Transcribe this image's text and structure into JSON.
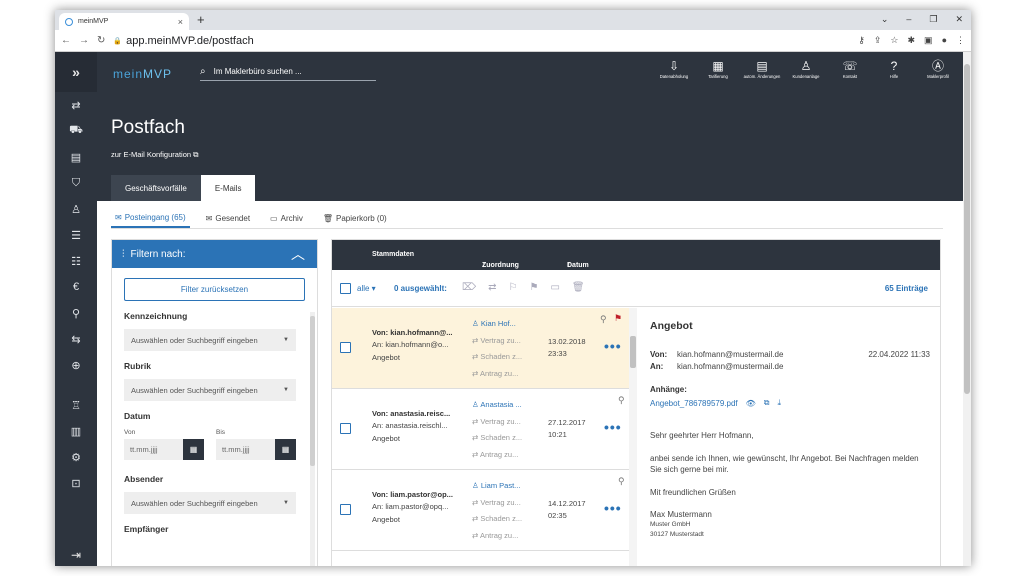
{
  "browser": {
    "tab_title": "meinMVP",
    "url": "app.meinMVP.de/postfach"
  },
  "app": {
    "logo_a": "mein",
    "logo_b": "MVP",
    "search_placeholder": "Im Maklerbüro suchen ...",
    "toolbar": [
      {
        "label": "Datenabholung",
        "icon": "data-retrieval-icon"
      },
      {
        "label": "Tarifierung",
        "icon": "calculator-icon"
      },
      {
        "label": "autom. Änderungen",
        "icon": "auto-changes-icon"
      },
      {
        "label": "Kundenanlage",
        "icon": "add-customer-icon"
      },
      {
        "label": "Kontakt",
        "icon": "contact-icon"
      },
      {
        "label": "Hilfe",
        "icon": "help-icon"
      },
      {
        "label": "Maklerprofil",
        "icon": "profile-icon"
      }
    ],
    "page_title": "Postfach",
    "config_link": "zur E-Mail Konfiguration",
    "tabs": [
      "Geschäftsvorfälle",
      "E-Mails"
    ],
    "subtabs": [
      "Posteingang (65)",
      "Gesendet",
      "Archiv",
      "Papierkorb (0)"
    ]
  },
  "filter": {
    "title": "Filtern nach:",
    "reset": "Filter zurücksetzen",
    "kennzeichnung": "Kennzeichnung",
    "rubrik": "Rubrik",
    "select_placeholder": "Auswählen oder Suchbegriff eingeben",
    "datum": "Datum",
    "von": "Von",
    "bis": "Bis",
    "date_placeholder": "tt.mm.jjjj",
    "absender": "Absender",
    "empfaenger": "Empfänger"
  },
  "list": {
    "col_stammdaten": "Stammdaten",
    "col_zuordnung": "Zuordnung",
    "col_datum": "Datum",
    "alle": "alle",
    "selected": "0 ausgewählt:",
    "count": "65 Einträge",
    "rows": [
      {
        "from": "Von: kian.hofmann@...",
        "to": "An: kian.hofmann@o...",
        "subject": "Angebot",
        "person": "Kian Hof...",
        "vertrag": "Vertrag zu...",
        "schaden": "Schaden z...",
        "antrag": "Antrag zu...",
        "date": "13.02.2018",
        "time": "23:33"
      },
      {
        "from": "Von: anastasia.reisc...",
        "to": "An: anastasia.reischl...",
        "subject": "Angebot",
        "person": "Anastasia ...",
        "vertrag": "Vertrag zu...",
        "schaden": "Schaden z...",
        "antrag": "Antrag zu...",
        "date": "27.12.2017",
        "time": "10:21"
      },
      {
        "from": "Von: liam.pastor@op...",
        "to": "An: liam.pastor@opq...",
        "subject": "Angebot",
        "person": "Liam Past...",
        "vertrag": "Vertrag zu...",
        "schaden": "Schaden z...",
        "antrag": "Antrag zu...",
        "date": "14.12.2017",
        "time": "02:35"
      }
    ]
  },
  "preview": {
    "subject": "Angebot",
    "von_label": "Von:",
    "an_label": "An:",
    "von": "kian.hofmann@mustermail.de",
    "an": "kian.hofmann@mustermail.de",
    "date": "22.04.2022 11:33",
    "attachments_label": "Anhänge:",
    "attachment": "Angebot_786789579.pdf",
    "greeting": "Sehr geehrter Herr Hofmann,",
    "body": "anbei sende ich Ihnen, wie gewünscht, Ihr Angebot. Bei Nachfragen melden Sie sich gerne bei mir.",
    "closing": "Mit freundlichen Grüßen",
    "sig_name": "Max Mustermann",
    "sig_company": "Muster GmbH",
    "sig_city": "30127 Musterstadt"
  },
  "colors": {
    "accent": "#2b73b6",
    "dark": "#2d343e",
    "highlight": "#fdf3dc",
    "flag": "#c0202b"
  }
}
